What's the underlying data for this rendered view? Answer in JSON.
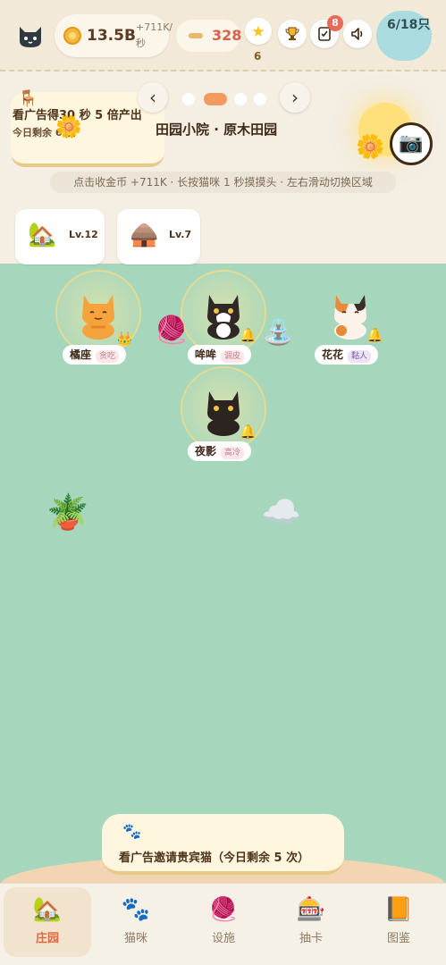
{
  "header": {
    "coins": "13.5B",
    "coin_rate": "+711K/秒",
    "fish": "328",
    "stars": "6",
    "task_badge": "8",
    "cat_count": "6/18只"
  },
  "banner": {
    "ad_title": "看广告得30 秒 5 倍产出",
    "ad_sub": "今日剩余 6 次",
    "area_title": "田园小院 · 原木田园",
    "hint": "点击收金币 +711K · 长按猫咪 1 秒摸摸头 · 左右滑动切换区域",
    "prev": "‹",
    "next": "›",
    "buildings": [
      {
        "level": "Lv.12",
        "icon": "house-icon"
      },
      {
        "level": "Lv.7",
        "icon": "cabin-icon"
      }
    ]
  },
  "cats": [
    {
      "name": "橘座",
      "trait": "贪吃",
      "color": "#f4a33d"
    },
    {
      "name": "哞哞",
      "trait": "调皮",
      "color": "#2f2826"
    },
    {
      "name": "花花",
      "trait": "黏人",
      "color": "#e78a3a"
    },
    {
      "name": "夜影",
      "trait": "高冷",
      "color": "#2b2420"
    }
  ],
  "guest_ad": "看广告邀请贵宾猫（今日剩余 5 次）",
  "nav": [
    {
      "label": "庄园",
      "icon": "house-icon"
    },
    {
      "label": "猫咪",
      "icon": "paw-icon"
    },
    {
      "label": "设施",
      "icon": "yarn-icon"
    },
    {
      "label": "抽卡",
      "icon": "capsule-machine-icon"
    },
    {
      "label": "图鉴",
      "icon": "book-icon"
    }
  ]
}
